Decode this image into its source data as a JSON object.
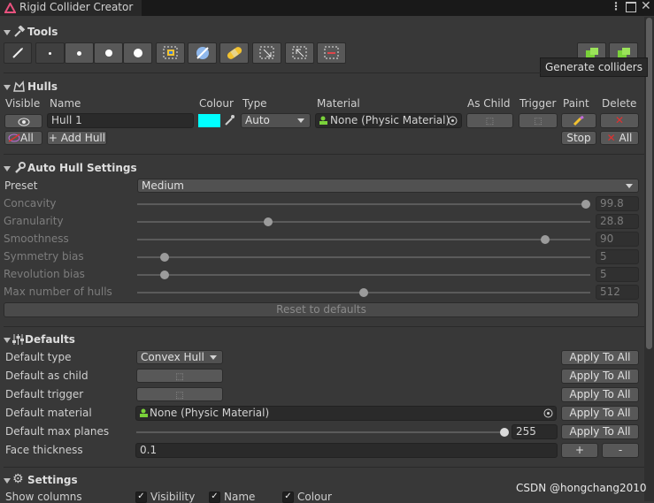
{
  "window": {
    "title": "Rigid Collider Creator",
    "menu_icon": "kebab-icon",
    "maximize_icon": "maximize-icon",
    "close_icon": "close-icon"
  },
  "tools": {
    "title": "Tools",
    "buttons": [
      {
        "name": "brush-tool-button",
        "icon": "brush-icon"
      },
      {
        "name": "dot-xs-button",
        "icon": "dot-icon"
      },
      {
        "name": "dot-s-button",
        "icon": "dot-icon"
      },
      {
        "name": "dot-m-button",
        "icon": "dot-icon"
      },
      {
        "name": "dot-l-button",
        "icon": "dot-icon"
      },
      {
        "name": "select-all-button",
        "icon": "select-all-icon"
      },
      {
        "name": "deselect-button",
        "icon": "deselect-icon"
      },
      {
        "name": "bandage-button",
        "icon": "bandage-icon"
      },
      {
        "name": "grow-selection-button",
        "icon": "grow-icon"
      },
      {
        "name": "shrink-selection-button",
        "icon": "shrink-icon"
      },
      {
        "name": "remove-selection-button",
        "icon": "remove-icon"
      }
    ],
    "generate_tooltip": "Generate colliders"
  },
  "hulls": {
    "title": "Hulls",
    "columns": {
      "visible": "Visible",
      "name": "Name",
      "colour": "Colour",
      "type": "Type",
      "material": "Material",
      "as_child": "As Child",
      "trigger": "Trigger",
      "paint": "Paint",
      "delete": "Delete"
    },
    "row": {
      "name": "Hull 1",
      "colour": "#00ffff",
      "type": "Auto",
      "material": "None (Physic Material)"
    },
    "all_label": "All",
    "add_hull_label": "+ Add Hull",
    "stop_label": "Stop",
    "delete_all_label": "All"
  },
  "auto_hull": {
    "title": "Auto Hull Settings",
    "preset_label": "Preset",
    "preset_value": "Medium",
    "sliders": [
      {
        "label": "Concavity",
        "value": "99.8",
        "fraction": 0.99
      },
      {
        "label": "Granularity",
        "value": "28.8",
        "fraction": 0.29
      },
      {
        "label": "Smoothness",
        "value": "90",
        "fraction": 0.9
      },
      {
        "label": "Symmetry bias",
        "value": "5",
        "fraction": 0.06
      },
      {
        "label": "Revolution bias",
        "value": "5",
        "fraction": 0.06
      },
      {
        "label": "Max number of hulls",
        "value": "512",
        "fraction": 0.5
      }
    ],
    "reset_label": "Reset to defaults"
  },
  "defaults": {
    "title": "Defaults",
    "rows": [
      {
        "label": "Default type",
        "value": "Convex Hull"
      },
      {
        "label": "Default as child",
        "value": ""
      },
      {
        "label": "Default trigger",
        "value": ""
      },
      {
        "label": "Default material",
        "value": "None (Physic Material)"
      },
      {
        "label": "Default max planes",
        "value": "255",
        "fraction": 1.0
      },
      {
        "label": "Face thickness",
        "value": "0.1"
      }
    ],
    "apply_label": "Apply To All",
    "plus_label": "+",
    "minus_label": "-"
  },
  "settings": {
    "title": "Settings",
    "show_columns_label": "Show columns",
    "columns": [
      {
        "label": "Visibility",
        "checked": true
      },
      {
        "label": "Name",
        "checked": true
      },
      {
        "label": "Colour",
        "checked": true
      }
    ]
  },
  "watermark": "CSDN @hongchang2010"
}
